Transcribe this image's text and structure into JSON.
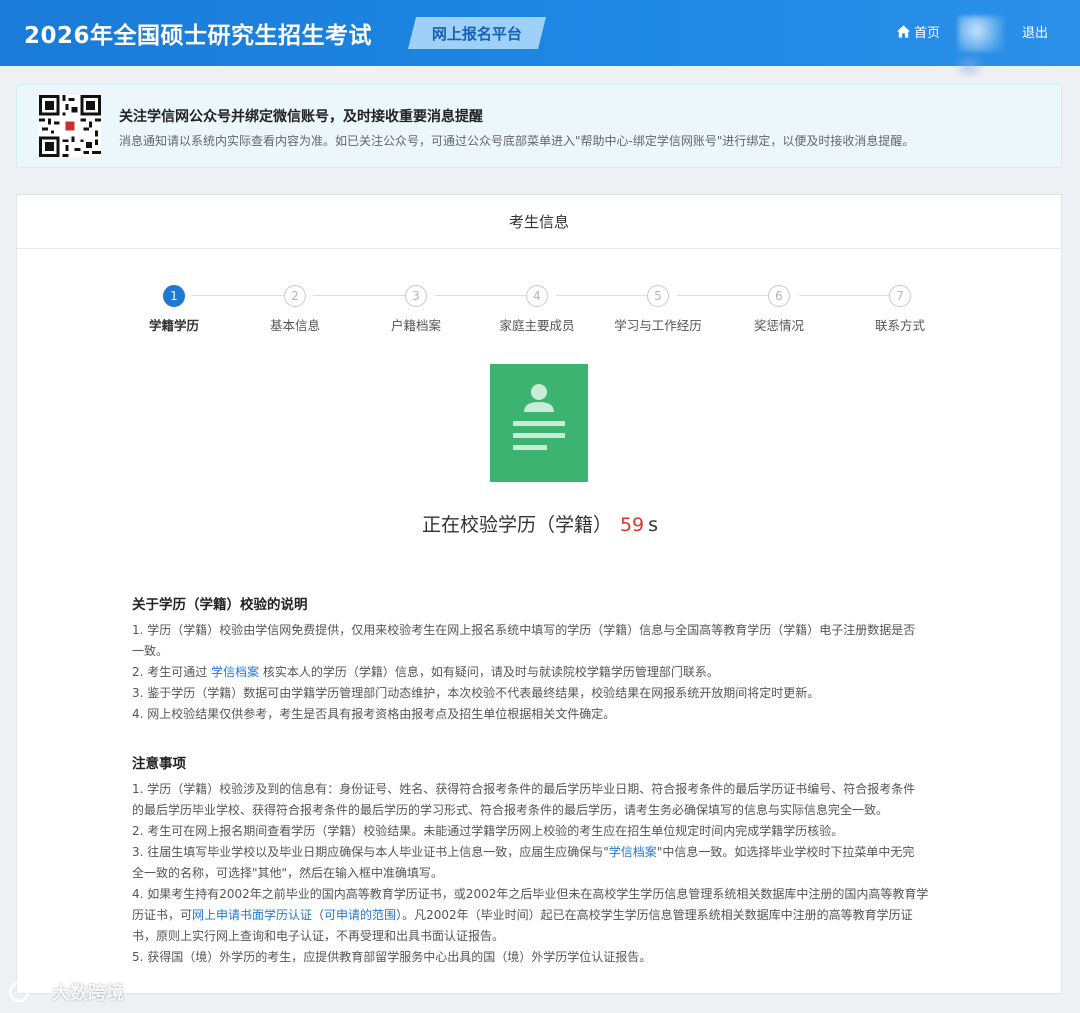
{
  "header": {
    "title": "2026年全国硕士研究生招生考试",
    "platform": "网上报名平台",
    "home": "首页",
    "logout": "退出"
  },
  "notice": {
    "title": "关注学信网公众号并绑定微信账号，及时接收重要消息提醒",
    "desc": "消息通知请以系统内实际查看内容为准。如已关注公众号，可通过公众号底部菜单进入\"帮助中心-绑定学信网账号\"进行绑定，以便及时接收消息提醒。"
  },
  "panel": {
    "title": "考生信息"
  },
  "steps": [
    {
      "num": "1",
      "label": "学籍学历"
    },
    {
      "num": "2",
      "label": "基本信息"
    },
    {
      "num": "3",
      "label": "户籍档案"
    },
    {
      "num": "4",
      "label": "家庭主要成员"
    },
    {
      "num": "5",
      "label": "学习与工作经历"
    },
    {
      "num": "6",
      "label": "奖惩情况"
    },
    {
      "num": "7",
      "label": "联系方式"
    }
  ],
  "verify": {
    "text": "正在校验学历（学籍）",
    "countdown": "59",
    "unit": "s"
  },
  "explain": {
    "title": "关于学历（学籍）校验的说明",
    "l1a": "1. 学历（学籍）校验由学信网免费提供，仅用来校验考生在网上报名系统中填写的学历（学籍）信息与全国高等教育学历（学籍）电子注册数据是否",
    "l1b": "一致。",
    "l2_pre": "2. 考生可通过 ",
    "l2_link": "学信档案",
    "l2_post": " 核实本人的学历（学籍）信息，如有疑问，请及时与就读院校学籍学历管理部门联系。",
    "l3": "3. 鉴于学历（学籍）数据可由学籍学历管理部门动态维护，本次校验不代表最终结果，校验结果在网报系统开放期间将定时更新。",
    "l4": "4. 网上校验结果仅供参考，考生是否具有报考资格由报考点及招生单位根据相关文件确定。"
  },
  "notes": {
    "title": "注意事项",
    "l1a": "1. 学历（学籍）校验涉及到的信息有：身份证号、姓名、获得符合报考条件的最后学历毕业日期、符合报考条件的最后学历证书编号、符合报考条件",
    "l1b": "的最后学历毕业学校、获得符合报考条件的最后学历的学习形式、符合报考条件的最后学历，请考生务必确保填写的信息与实际信息完全一致。",
    "l2": "2. 考生可在网上报名期间查看学历（学籍）校验结果。未能通过学籍学历网上校验的考生应在招生单位规定时间内完成学籍学历核验。",
    "l3a_pre": "3. 往届生填写毕业学校以及毕业日期应确保与本人毕业证书上信息一致，应届生应确保与\"",
    "l3a_link": "学信档案",
    "l3a_post": "\"中信息一致。如选择毕业学校时下拉菜单中无完",
    "l3b": "全一致的名称，可选择\"其他\"，然后在输入框中准确填写。",
    "l4a": "4. 如果考生持有2002年之前毕业的国内高等教育学历证书，或2002年之后毕业但未在高校学生学历信息管理系统相关数据库中注册的国内高等教育学",
    "l4b_pre": "历证书，可",
    "l4b_link1": "网上申请书面学历认证",
    "l4b_mid1": "（",
    "l4b_link2": "可申请的范围",
    "l4b_post": "）。凡2002年（毕业时间）起已在高校学生学历信息管理系统相关数据库中注册的高等教育学历证",
    "l4c": "书，原则上实行网上查询和电子认证，不再受理和出具书面认证报告。",
    "l5": "5. 获得国（境）外学历的考生，应提供教育部留学服务中心出具的国（境）外学历学位认证报告。"
  },
  "watermark": "大数跨境"
}
